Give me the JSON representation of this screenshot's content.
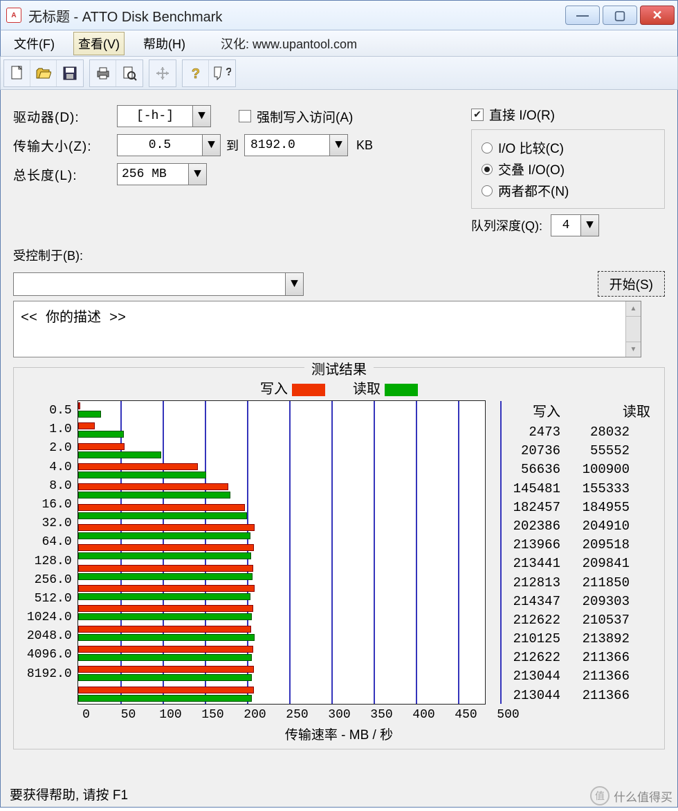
{
  "window": {
    "title": "无标题 - ATTO Disk Benchmark"
  },
  "menu": {
    "file": "文件(F)",
    "view": "查看(V)",
    "help": "帮助(H)",
    "extra": "汉化: www.upantool.com"
  },
  "toolbar_icons": [
    "new",
    "open",
    "save",
    "print",
    "preview",
    "move",
    "help",
    "whatsthis"
  ],
  "form": {
    "drive_label": "驱动器(D):",
    "drive_value": "[-h-]",
    "transfer_label": "传输大小(Z):",
    "transfer_min": "0.5",
    "to_label": "到",
    "transfer_max": "8192.0",
    "unit": "KB",
    "length_label": "总长度(L):",
    "length_value": "256 MB",
    "force_write": "强制写入访问(A)",
    "direct_io": "直接 I/O(R)",
    "io_compare": "I/O 比较(C)",
    "overlap_io": "交叠 I/O(O)",
    "neither": "两者都不(N)",
    "queue_label": "队列深度(Q):",
    "queue_value": "4",
    "controlled_label": "受控制于(B):",
    "controlled_value": "",
    "start": "开始(S)"
  },
  "description": {
    "text": "<<  你的描述   >>"
  },
  "results": {
    "title": "测试结果",
    "write_label": "写入",
    "read_label": "读取",
    "xlabel": "传输速率 - MB / 秒"
  },
  "status": "要获得帮助, 请按 F1",
  "watermark": "什么值得买",
  "chart_data": {
    "type": "bar",
    "xlabel": "传输速率 - MB / 秒",
    "xlim": [
      0,
      500
    ],
    "xticks": [
      0,
      50,
      100,
      150,
      200,
      250,
      300,
      350,
      400,
      450,
      500
    ],
    "categories": [
      "0.5",
      "1.0",
      "2.0",
      "4.0",
      "8.0",
      "16.0",
      "32.0",
      "64.0",
      "128.0",
      "256.0",
      "512.0",
      "1024.0",
      "2048.0",
      "4096.0",
      "8192.0"
    ],
    "series": [
      {
        "name": "写入",
        "color": "#ee3300",
        "raw_kb": [
          2473,
          20736,
          56636,
          145481,
          182457,
          202386,
          213966,
          213441,
          212813,
          214347,
          212622,
          210125,
          212622,
          213044,
          213044
        ],
        "values_mb": [
          2.4,
          20.2,
          55.3,
          142.1,
          178.2,
          197.6,
          209.0,
          208.4,
          207.8,
          209.3,
          207.6,
          205.2,
          207.6,
          208.1,
          208.1
        ]
      },
      {
        "name": "读取",
        "color": "#00aa00",
        "raw_kb": [
          28032,
          55552,
          100900,
          155333,
          184955,
          204910,
          209518,
          209841,
          211850,
          209303,
          210537,
          213892,
          211366,
          211366,
          211366
        ],
        "values_mb": [
          27.4,
          54.2,
          98.5,
          151.7,
          180.6,
          200.1,
          204.6,
          204.9,
          206.9,
          204.4,
          205.6,
          208.9,
          206.4,
          206.4,
          206.4
        ]
      }
    ]
  }
}
